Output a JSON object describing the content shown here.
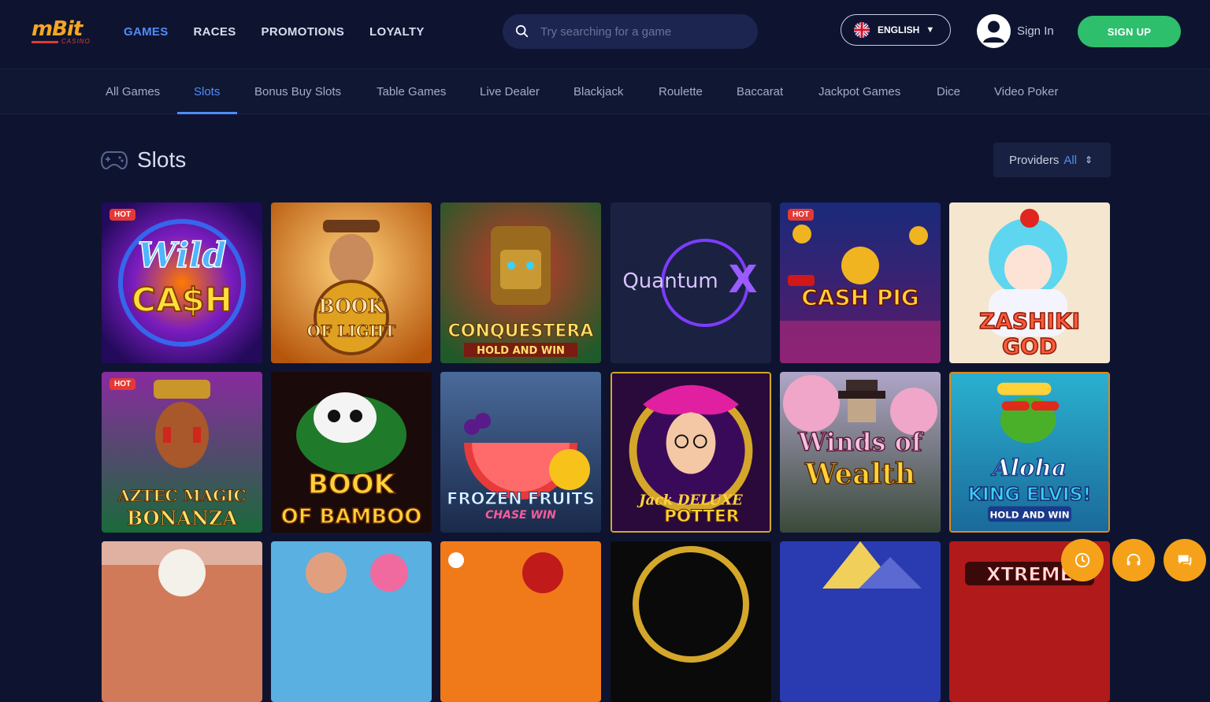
{
  "brand": {
    "logo_text": "mBit",
    "logo_sub": "CASINO"
  },
  "nav": [
    {
      "label": "GAMES",
      "active": true
    },
    {
      "label": "RACES",
      "active": false
    },
    {
      "label": "PROMOTIONS",
      "active": false
    },
    {
      "label": "LOYALTY",
      "active": false
    }
  ],
  "search": {
    "placeholder": "Try searching for a game",
    "icon": "search-icon"
  },
  "language": {
    "label": "ENGLISH",
    "flag": "uk-flag-icon"
  },
  "auth": {
    "signin_label": "Sign In",
    "signup_label": "SIGN UP"
  },
  "categories": [
    {
      "label": "All Games",
      "active": false
    },
    {
      "label": "Slots",
      "active": true
    },
    {
      "label": "Bonus Buy Slots",
      "active": false
    },
    {
      "label": "Table Games",
      "active": false
    },
    {
      "label": "Live Dealer",
      "active": false
    },
    {
      "label": "Blackjack",
      "active": false
    },
    {
      "label": "Roulette",
      "active": false
    },
    {
      "label": "Baccarat",
      "active": false
    },
    {
      "label": "Jackpot Games",
      "active": false
    },
    {
      "label": "Dice",
      "active": false
    },
    {
      "label": "Video Poker",
      "active": false
    }
  ],
  "section": {
    "title": "Slots",
    "icon": "gamepad-icon"
  },
  "providers": {
    "label": "Providers",
    "value": "All"
  },
  "games": [
    {
      "title_line1": "Wild",
      "title_line2": "CA$H",
      "badge": "HOT"
    },
    {
      "title_line1": "BOOK",
      "title_line2": "OF LIGHT",
      "badge": ""
    },
    {
      "title_line1": "CONQUESTERA",
      "title_line2": "HOLD AND WIN",
      "badge": ""
    },
    {
      "title_line1": "Quantum",
      "title_line2": "X",
      "badge": ""
    },
    {
      "title_line1": "CASH PIG",
      "title_line2": "",
      "badge": "HOT"
    },
    {
      "title_line1": "ZASHIKI",
      "title_line2": "GOD",
      "badge": ""
    },
    {
      "title_line1": "AZTEC MAGIC",
      "title_line2": "BONANZA",
      "badge": "HOT"
    },
    {
      "title_line1": "BOOK",
      "title_line2": "OF BAMBOO",
      "badge": ""
    },
    {
      "title_line1": "FROZEN FRUITS",
      "title_line2": "CHASE WIN",
      "badge": ""
    },
    {
      "title_line1": "Jack DELUXE",
      "title_line2": "POTTER",
      "badge": ""
    },
    {
      "title_line1": "Winds of",
      "title_line2": "Wealth",
      "badge": ""
    },
    {
      "title_line1": "Aloha",
      "title_line2": "KING ELVIS!",
      "sub": "HOLD AND WIN",
      "badge": ""
    },
    {
      "title_line1": "",
      "title_line2": "",
      "badge": ""
    },
    {
      "title_line1": "",
      "title_line2": "",
      "badge": ""
    },
    {
      "title_line1": "",
      "title_line2": "",
      "badge": ""
    },
    {
      "title_line1": "",
      "title_line2": "",
      "badge": ""
    },
    {
      "title_line1": "",
      "title_line2": "",
      "badge": ""
    },
    {
      "title_line1": "XTREME",
      "title_line2": "",
      "badge": ""
    }
  ],
  "floating_buttons": [
    {
      "icon": "history-icon"
    },
    {
      "icon": "headset-icon"
    },
    {
      "icon": "chat-icon"
    }
  ],
  "colors": {
    "background": "#0e1430",
    "accent": "#4f8cf5",
    "signup": "#2ebf6d",
    "hot_badge": "#e53935",
    "fab": "#f5a21a"
  }
}
